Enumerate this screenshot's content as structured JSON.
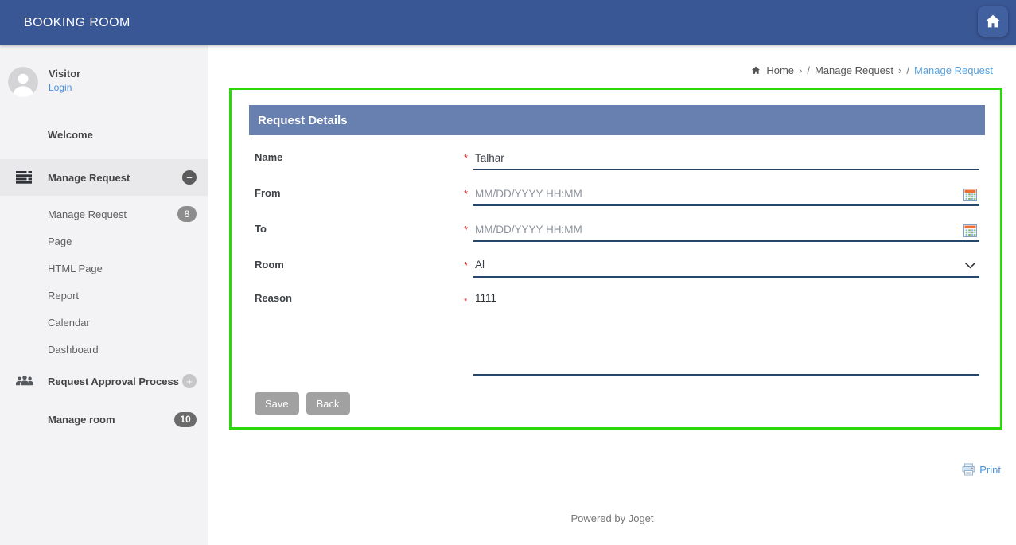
{
  "header": {
    "title": "BOOKING ROOM"
  },
  "sidebar": {
    "user": {
      "name": "Visitor",
      "login_label": "Login"
    },
    "items": [
      {
        "label": "Welcome",
        "style": "section"
      },
      {
        "label": "Manage Request",
        "style": "section",
        "icon": "list-icon",
        "badge": "−",
        "active": true
      },
      {
        "label": "Manage Request",
        "style": "sub",
        "badge": "8"
      },
      {
        "label": "Page",
        "style": "sub"
      },
      {
        "label": "HTML Page",
        "style": "sub"
      },
      {
        "label": "Report",
        "style": "sub"
      },
      {
        "label": "Calendar",
        "style": "sub"
      },
      {
        "label": "Dashboard",
        "style": "sub"
      },
      {
        "label": "Request Approval Process",
        "style": "section",
        "icon": "users-icon",
        "badge": "+"
      },
      {
        "label": "Manage room",
        "style": "section",
        "badge": "10"
      }
    ]
  },
  "breadcrumb": {
    "home": "Home",
    "sep_gt": "›",
    "sep_slash": "/",
    "parent": "Manage Request",
    "current": "Manage Request"
  },
  "form": {
    "title": "Request Details",
    "required_marker": "*",
    "fields": {
      "name": {
        "label": "Name",
        "value": "Talhar"
      },
      "from": {
        "label": "From",
        "placeholder": "MM/DD/YYYY HH:MM"
      },
      "to": {
        "label": "To",
        "placeholder": "MM/DD/YYYY HH:MM"
      },
      "room": {
        "label": "Room",
        "value": "Al"
      },
      "reason": {
        "label": "Reason",
        "value": "1111"
      }
    },
    "buttons": {
      "save": "Save",
      "back": "Back"
    }
  },
  "footer": {
    "print_label": "Print",
    "powered_by": "Powered by Joget"
  },
  "colors": {
    "header_bg": "#3a5795",
    "panel_header_bg": "#6880b0",
    "highlight_border": "#2bd60b",
    "link_blue": "#4a90d9"
  }
}
